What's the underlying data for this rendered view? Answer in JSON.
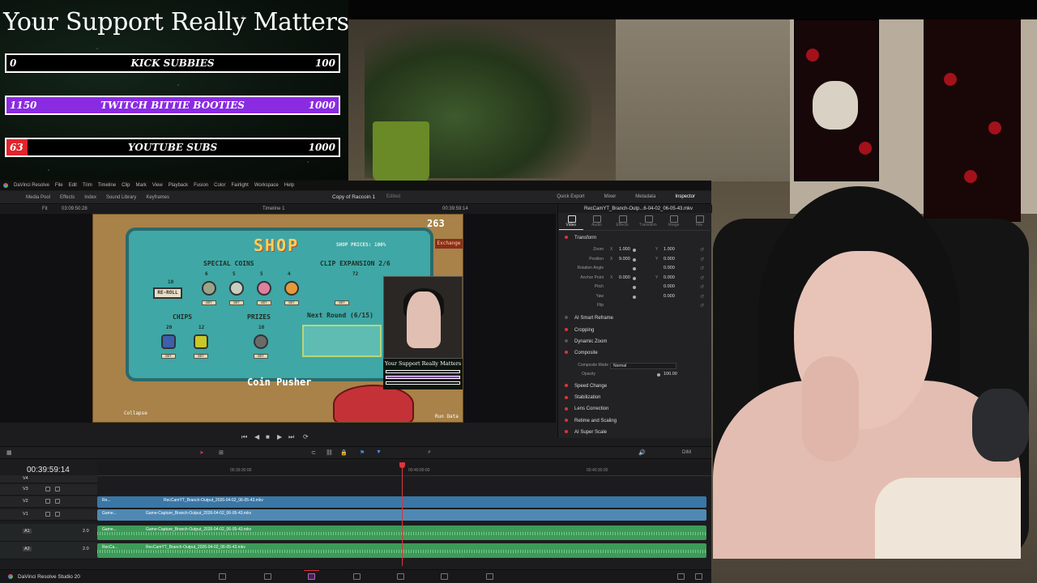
{
  "overlay": {
    "title": "Your Support Really Matters",
    "goals": [
      {
        "current": "0",
        "label": "KICK SUBBIES",
        "target": "100",
        "fill_fraction": 0.0,
        "color": "#000000"
      },
      {
        "current": "1150",
        "label": "TWITCH BITTIE BOOTIES",
        "target": "1000",
        "fill_fraction": 1.0,
        "color": "#8a2be2"
      },
      {
        "current": "63",
        "label": "YOUTUBE SUBS",
        "target": "1000",
        "fill_fraction": 0.063,
        "color": "#e0242c"
      }
    ]
  },
  "resolve": {
    "menu": [
      "DaVinci Resolve",
      "File",
      "Edit",
      "Trim",
      "Timeline",
      "Clip",
      "Mark",
      "View",
      "Playback",
      "Fusion",
      "Color",
      "Fairlight",
      "Workspace",
      "Help"
    ],
    "toolbar_left": [
      "Media Pool",
      "Effects",
      "Index",
      "Sound Library",
      "Keyframes"
    ],
    "project_title": "Copy of Raccoin 1",
    "project_status": "Edited",
    "toolbar_right": [
      "Quick Export",
      "Mixer",
      "Metadata",
      "Inspector"
    ],
    "viewer": {
      "fit": "Fit",
      "source_tc": "03:09:50:28",
      "timeline_name": "Timeline 1",
      "record_tc": "00:39:59:14"
    },
    "game": {
      "logo": "SHOP",
      "counter": "263",
      "exchange": "Exchange",
      "shop_prices": "SHOP PRICES: 100%",
      "special_coins": "SPECIAL COINS",
      "clip_expansion": "CLIP EXPANSION 2/6",
      "reroll": "RE-ROLL",
      "reroll_cost": "10",
      "chips": "CHIPS",
      "prizes": "PRIZES",
      "next_round": "Next Round (6/15)",
      "coin_pusher": "Coin Pusher",
      "collapse": "Collapse",
      "run_data": "Run Data",
      "buy": "BUY",
      "prices": [
        "6",
        "5",
        "5",
        "4",
        "20",
        "12",
        "10",
        "72"
      ],
      "pip_title": "Your Support Really Matters"
    },
    "inspector": {
      "clip_name": "RecCamYT_Branch-Outp...6-04-02_06-05-43.mkv",
      "tabs": [
        "Video",
        "Audio",
        "Effects",
        "Transition",
        "Image",
        "File"
      ],
      "transform_label": "Transform",
      "props": [
        {
          "label": "Zoom",
          "x_label": "X",
          "x": "1.000",
          "y_label": "Y",
          "y": "1.000"
        },
        {
          "label": "Position",
          "x_label": "X",
          "x": "9.000",
          "y_label": "Y",
          "y": "0.000"
        },
        {
          "label": "Rotation Angle",
          "x_label": "",
          "x": "",
          "y_label": "",
          "y": "0.000"
        },
        {
          "label": "Anchor Point",
          "x_label": "X",
          "x": "0.000",
          "y_label": "Y",
          "y": "0.000"
        },
        {
          "label": "Pitch",
          "x_label": "",
          "x": "",
          "y_label": "",
          "y": "0.000"
        },
        {
          "label": "Yaw",
          "x_label": "",
          "x": "",
          "y_label": "",
          "y": "0.000"
        },
        {
          "label": "Flip",
          "x_label": "",
          "x": "",
          "y_label": "",
          "y": ""
        }
      ],
      "smart_reframe": "AI Smart Reframe",
      "cropping": "Cropping",
      "dynamic_zoom": "Dynamic Zoom",
      "composite": "Composite",
      "composite_mode_label": "Composite Mode",
      "composite_mode": "Normal",
      "opacity_label": "Opacity",
      "opacity": "100.00",
      "sections": [
        "Speed Change",
        "Stabilization",
        "Lens Correction",
        "Retime and Scaling",
        "AI Super Scale"
      ]
    },
    "timeline": {
      "timecode": "00:39:59:14",
      "ruler": [
        "00:39:30:00",
        "00:40:00:00",
        "00:40:30:00"
      ],
      "tracks": [
        {
          "id": "V3",
          "clip": ""
        },
        {
          "id": "V2",
          "clip": "RecCamYT_Branch-Output_2026-04-02_06-05-43.mkv"
        },
        {
          "id": "V1",
          "clip": "Game-Capture_Branch-Output_2026-04-02_06-05-43.mkv"
        },
        {
          "id": "A1",
          "clip": "Game-Capture_Branch-Output_2026-04-02_06-05-43.mkv",
          "level": "2.0"
        },
        {
          "id": "A2",
          "clip": "RecCamYT_Branch-Output_2026-04-02_06-05-43.mkv",
          "level": "2.0"
        }
      ],
      "v4": "V4",
      "clip_prefix_v2": "Re...",
      "clip_prefix_v1": "Game...",
      "clip_prefix_a1": "Game...",
      "clip_prefix_a2": "RecCa...",
      "dim": "DIM"
    },
    "app_name": "DaVinci Resolve Studio 20"
  }
}
